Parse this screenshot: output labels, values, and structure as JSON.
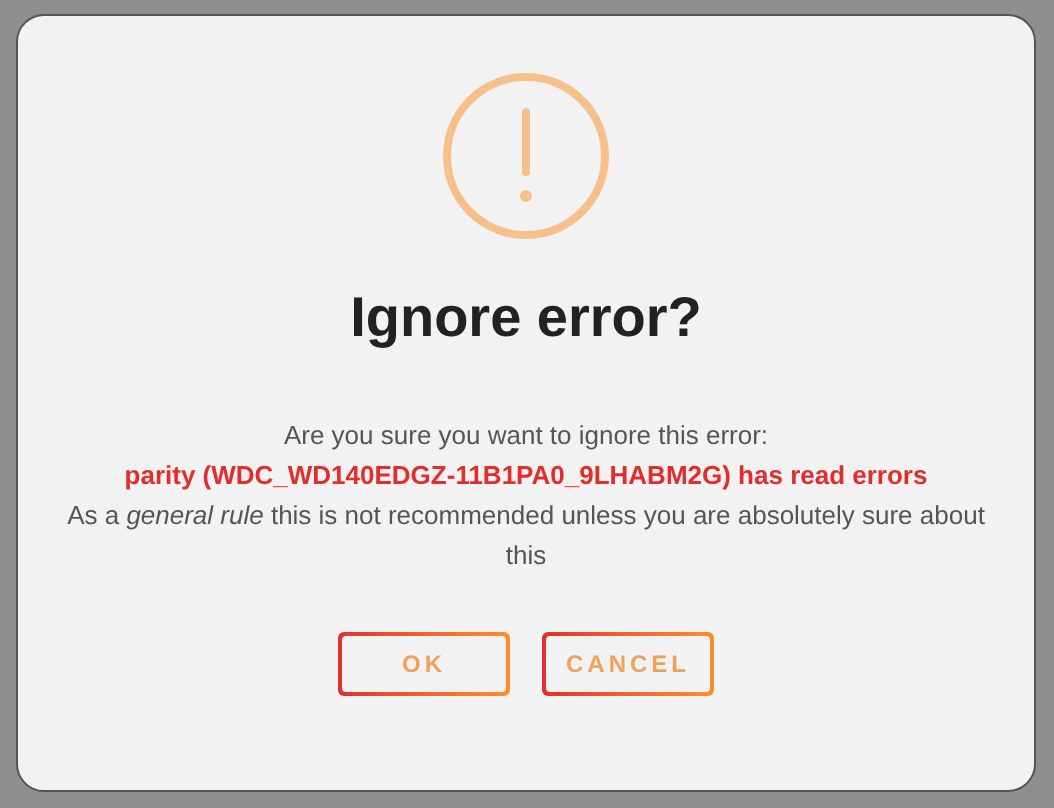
{
  "dialog": {
    "title": "Ignore error?",
    "message": "Are you sure you want to ignore this error:",
    "error": "parity (WDC_WD140EDGZ-11B1PA0_9LHABM2G) has read errors",
    "note": "As a *general rule* this is not recommended unless you are absolutely sure about this"
  },
  "buttons": [
    {
      "label": "OK"
    },
    {
      "label": "CANCEL"
    }
  ]
}
